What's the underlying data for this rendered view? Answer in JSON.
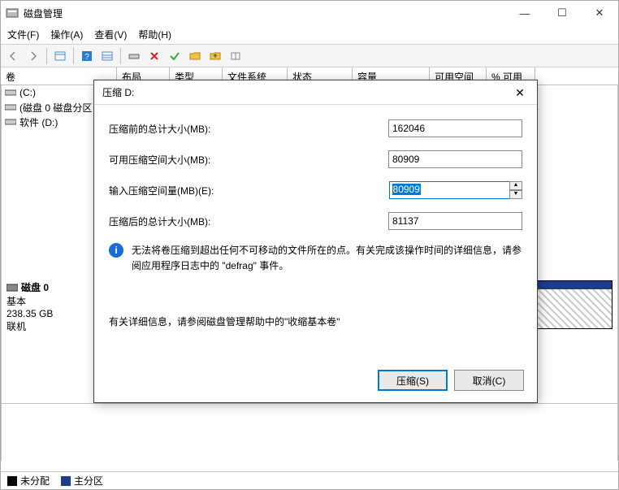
{
  "window": {
    "title": "磁盘管理"
  },
  "menu": {
    "file": "文件(F)",
    "action": "操作(A)",
    "view": "查看(V)",
    "help": "帮助(H)"
  },
  "columns": {
    "vol": "卷",
    "layout": "布局",
    "type": "类型",
    "fs": "文件系统",
    "status": "状态",
    "capacity": "容量",
    "free": "可用空间",
    "pctfree": "% 可用"
  },
  "volumes": [
    {
      "name": "(C:)"
    },
    {
      "name": "(磁盘 0 磁盘分区"
    },
    {
      "name": "软件 (D:)"
    }
  ],
  "disk": {
    "name": "磁盘 0",
    "kind": "基本",
    "size": "238.35 GB",
    "state": "联机"
  },
  "legend": {
    "unalloc": "未分配",
    "primary": "主分区"
  },
  "dialog": {
    "title": "压缩 D:",
    "labels": {
      "total_before": "压缩前的总计大小(MB):",
      "avail": "可用压缩空间大小(MB):",
      "input": "输入压缩空间量(MB)(E):",
      "total_after": "压缩后的总计大小(MB):"
    },
    "values": {
      "total_before": "162046",
      "avail": "80909",
      "input": "80909",
      "total_after": "81137"
    },
    "info": "无法将卷压缩到超出任何不可移动的文件所在的点。有关完成该操作时间的详细信息，请参阅应用程序日志中的 \"defrag\" 事件。",
    "help": "有关详细信息，请参阅磁盘管理帮助中的\"收缩基本卷\"",
    "buttons": {
      "shrink": "压缩(S)",
      "cancel": "取消(C)"
    }
  }
}
